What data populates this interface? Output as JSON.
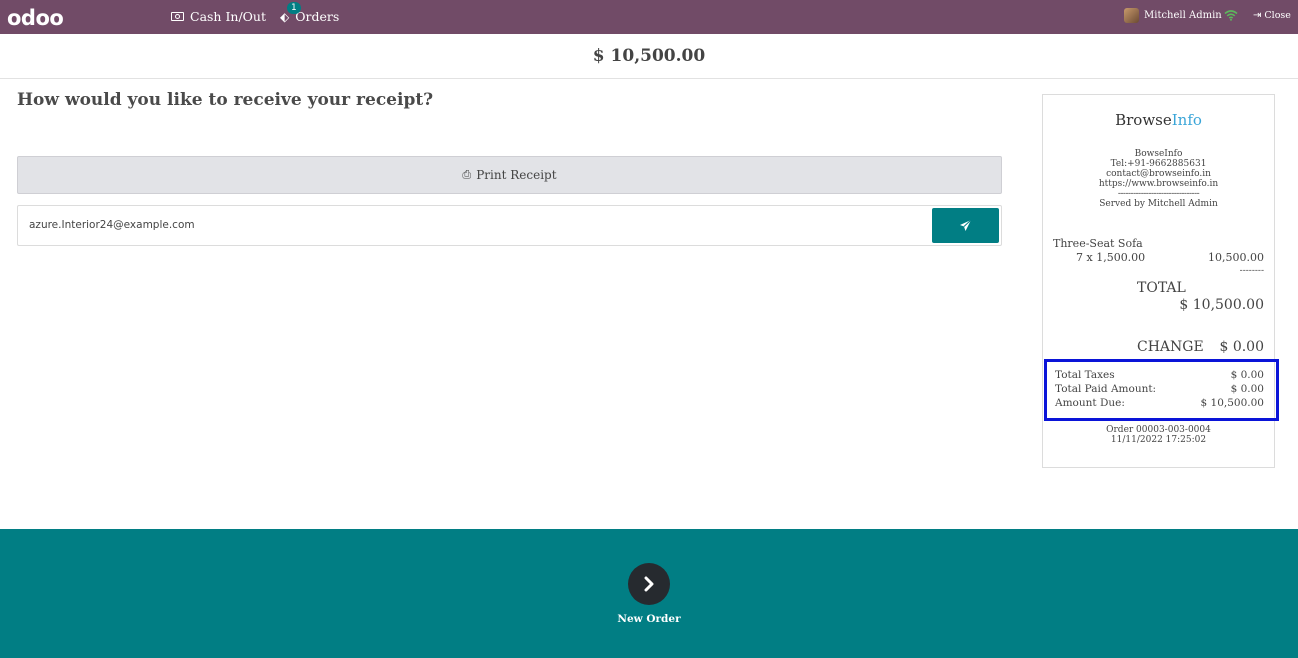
{
  "navbar": {
    "logo": "odoo",
    "cash_label": "Cash In/Out",
    "orders_label": "Orders",
    "orders_badge": "1",
    "user_name": "Mitchell Admin",
    "close_label": "Close"
  },
  "amount_due_header": "$ 10,500.00",
  "receipt_screen": {
    "question": "How would you like to receive your receipt?",
    "print_label": "Print Receipt",
    "email_value": "azure.Interior24@example.com"
  },
  "receipt": {
    "brand_a": "Browse",
    "brand_b": "Info",
    "company": "BowseInfo",
    "phone": "Tel:+91-9662885631",
    "email": "contact@browseinfo.in",
    "website": "https://www.browseinfo.in",
    "separator": "--------------------------------",
    "served_by": "Served by Mitchell Admin",
    "lines": [
      {
        "product": "Three-Seat Sofa",
        "qty_price": "7 x 1,500.00",
        "subtotal": "10,500.00"
      }
    ],
    "divider": "--------",
    "total_label": "TOTAL",
    "total_amount": "$ 10,500.00",
    "change_label": "CHANGE",
    "change_amount": "$ 0.00",
    "summary": [
      {
        "label": "Total Taxes",
        "value": "$ 0.00"
      },
      {
        "label": "Total Paid Amount:",
        "value": "$ 0.00"
      },
      {
        "label": "Amount Due:",
        "value": "$ 10,500.00"
      }
    ],
    "order_ref": "Order 00003-003-0004",
    "order_datetime": "11/11/2022 17:25:02"
  },
  "footer": {
    "next_label": "New Order"
  },
  "colors": {
    "navbar": "#714b67",
    "teal": "#017e84",
    "highlight_border": "#0a14d8",
    "brand_info": "#3aa5d8"
  }
}
